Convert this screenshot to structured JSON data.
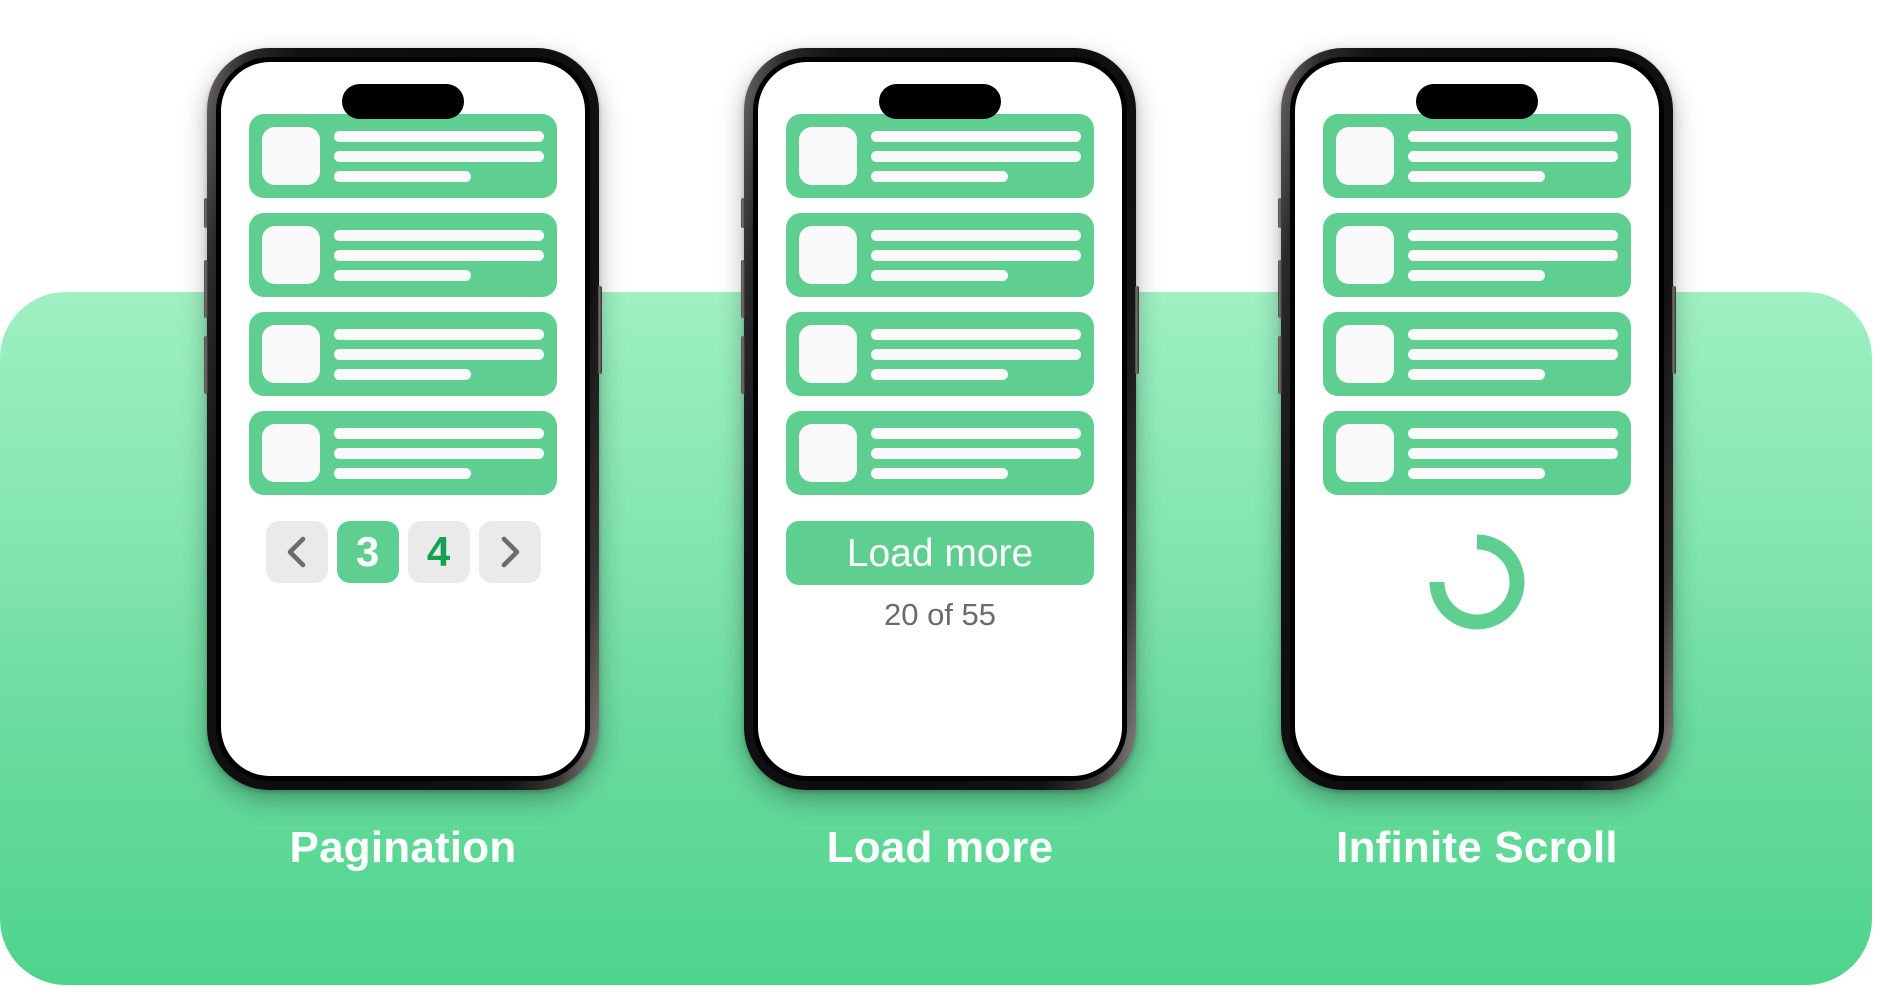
{
  "theme": {
    "panel_top_color": "#9EF0C2",
    "panel_bottom_color": "#4ED48C",
    "card_green": "#5FCF91",
    "accent_green": "#5FCF91",
    "dark_green_text": "#14A055",
    "muted_grey": "#6B6B6B",
    "button_grey": "#EAEAEA",
    "white": "#FFFFFF"
  },
  "skeleton_card": {
    "line_full_label": "text-line",
    "line_short_label": "text-line-short",
    "thumbnail_label": "thumbnail"
  },
  "columns": [
    {
      "id": "pagination",
      "caption": "Pagination",
      "card_count": 4,
      "footer_type": "pagination",
      "pagination": {
        "prev_icon": "chevron-left-icon",
        "next_icon": "chevron-right-icon",
        "pages": [
          {
            "label": "3",
            "active": true
          },
          {
            "label": "4",
            "active": false
          }
        ]
      }
    },
    {
      "id": "load-more",
      "caption": "Load more",
      "card_count": 4,
      "footer_type": "load-more",
      "load_more": {
        "button_label": "Load more",
        "count_label": "20 of 55",
        "loaded": 20,
        "total": 55
      }
    },
    {
      "id": "infinite-scroll",
      "caption": "Infinite Scroll",
      "card_count": 4,
      "footer_type": "spinner",
      "spinner": {
        "icon": "loading-spinner-icon",
        "color": "#5FCF91"
      }
    }
  ]
}
